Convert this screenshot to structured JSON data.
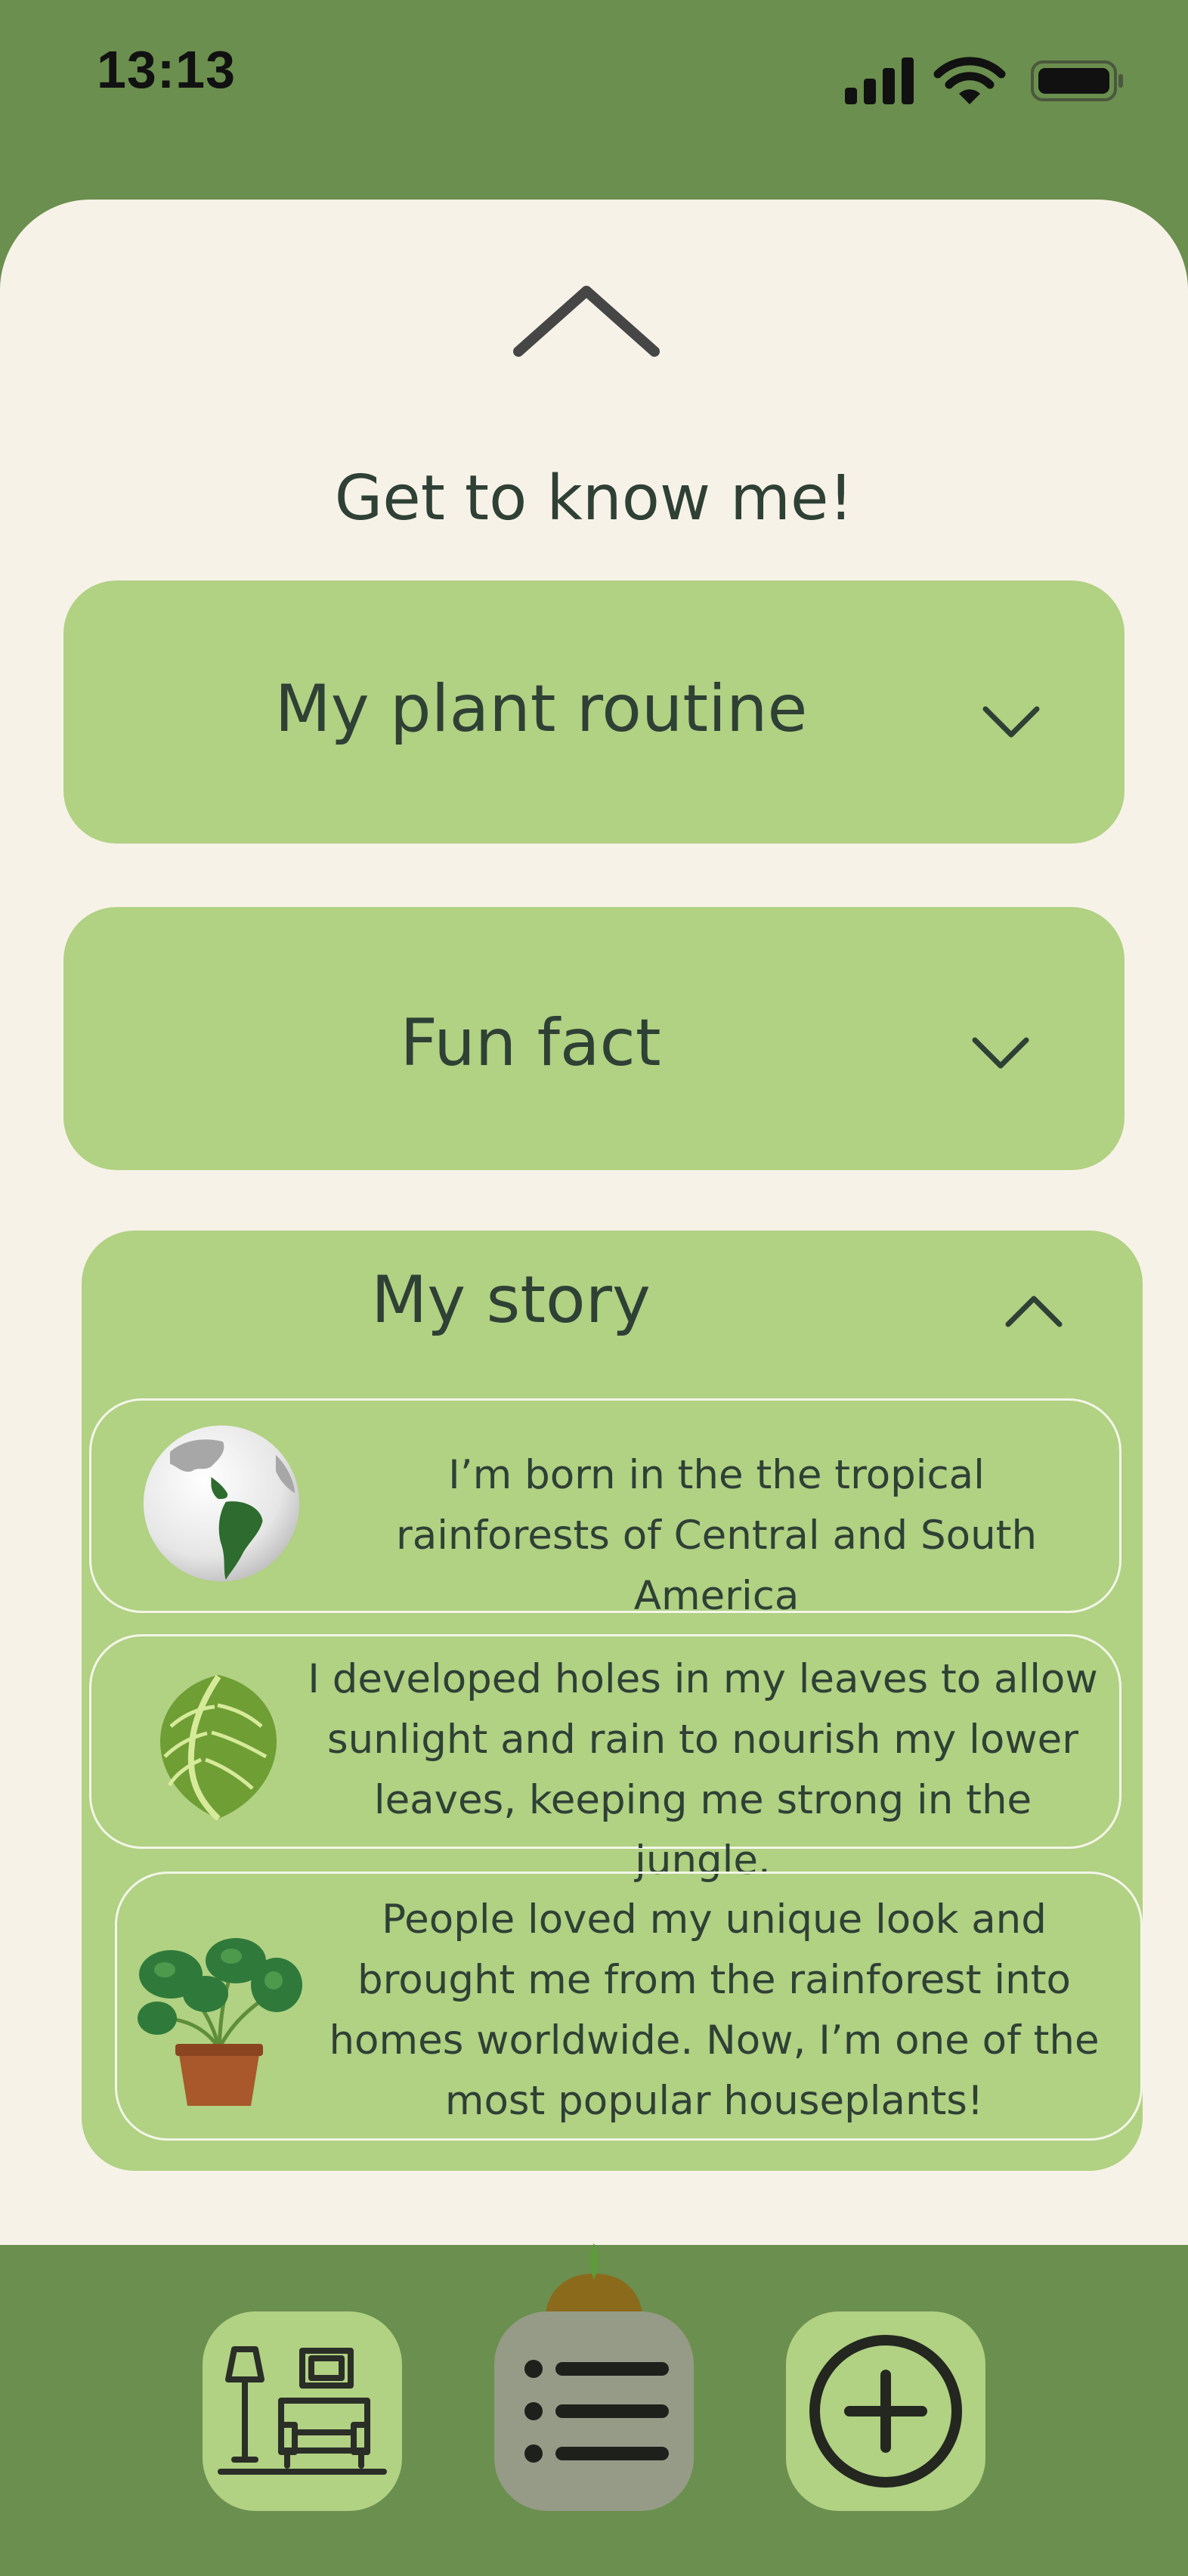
{
  "status_bar": {
    "time": "13:13"
  },
  "sheet": {
    "title": "Get to know me!"
  },
  "cards": [
    {
      "title": "My plant routine",
      "expanded": false
    },
    {
      "title": "Fun fact",
      "expanded": false
    },
    {
      "title": "My story",
      "expanded": true
    }
  ],
  "story": [
    {
      "icon": "globe-americas-icon",
      "text": "I’m born in the the tropical rainforests of Central and South America"
    },
    {
      "icon": "monstera-leaf-icon",
      "text": "I developed holes in my leaves to allow sunlight and rain to nourish my lower leaves, keeping me strong in the jungle."
    },
    {
      "icon": "potted-plant-icon",
      "text": "People loved my unique look and brought me from the rainforest into homes worldwide. Now, I’m one of the most popular houseplants!"
    }
  ],
  "nav": [
    {
      "icon": "living-room-icon",
      "active": false
    },
    {
      "icon": "list-icon",
      "active": true
    },
    {
      "icon": "add-circle-icon",
      "active": false
    }
  ],
  "colors": {
    "background": "#6B8F4E",
    "sheet": "#F7F2E7",
    "card": "#B1D183",
    "text": "#2F4035",
    "nav_active": "#959B86"
  }
}
